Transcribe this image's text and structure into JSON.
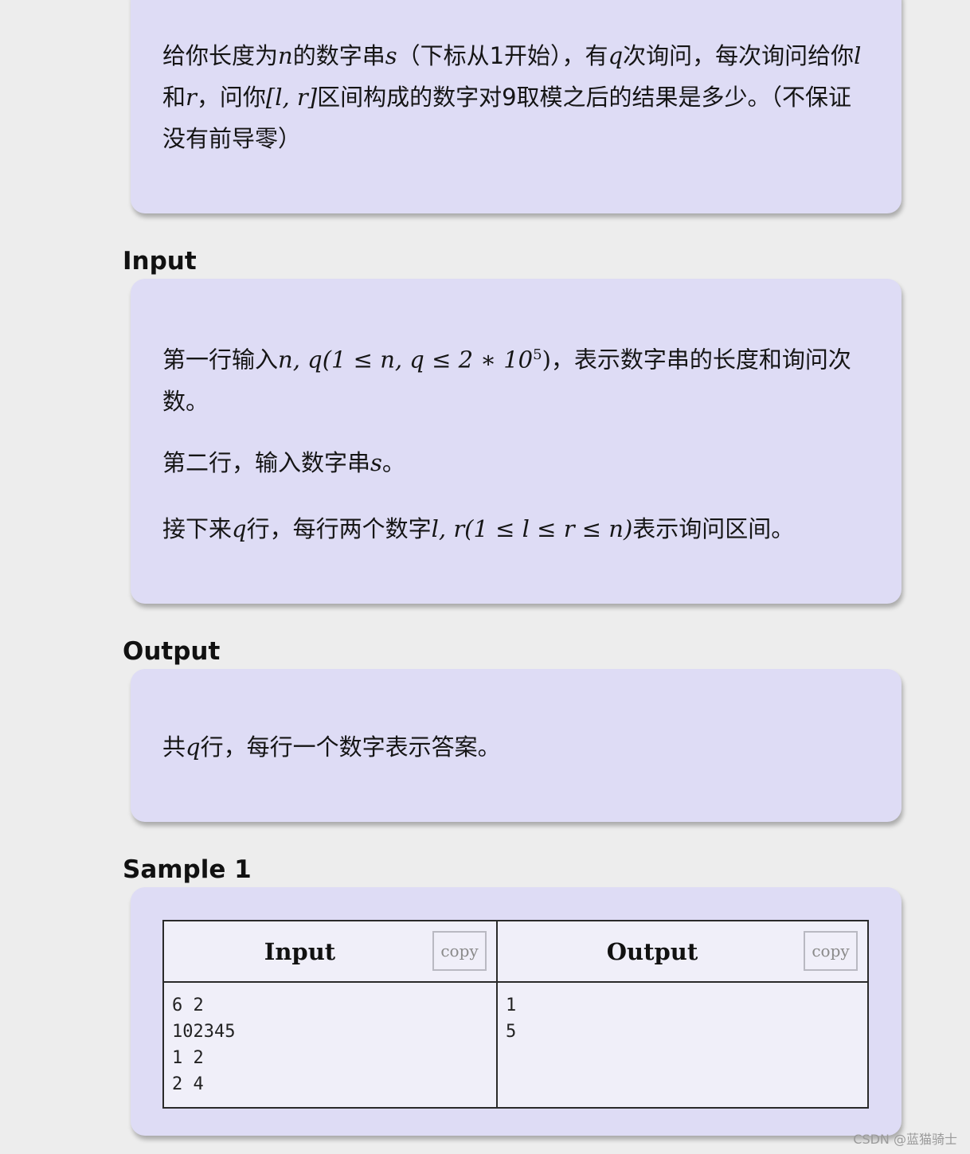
{
  "description": {
    "para1_a": "给你长度为",
    "para1_n": "n",
    "para1_b": "的数字串",
    "para1_s": "s",
    "para1_c": "（下标从1开始），有",
    "para1_q": "q",
    "para1_d": "次询问，每次询问给你",
    "para1_l": "l",
    "para1_e": "和",
    "para1_r": "r",
    "para1_f": "，问你",
    "para1_range": "[l, r]",
    "para1_g": "区间构成的数字对9取模之后的结果是多少。（不保证没有前导零）"
  },
  "input_section": {
    "heading": "Input",
    "line1_a": "第一行输入",
    "line1_math": "n, q(1 ≤ n, q ≤ 2 ∗ 10",
    "line1_exp": "5",
    "line1_close": ")",
    "line1_b": "，表示数字串的长度和询问次数。",
    "line2_a": "第二行，输入数字串",
    "line2_s": "s",
    "line2_b": "。",
    "line3_a": "接下来",
    "line3_q": "q",
    "line3_b": "行，每行两个数字",
    "line3_math": "l, r(1 ≤ l ≤ r ≤ n)",
    "line3_c": "表示询问区间。"
  },
  "output_section": {
    "heading": "Output",
    "line_a": "共",
    "line_q": "q",
    "line_b": "行，每行一个数字表示答案。"
  },
  "sample": {
    "heading": "Sample 1",
    "input_header": "Input",
    "output_header": "Output",
    "copy_label": "copy",
    "input_text": "6 2\n102345\n1 2\n2 4",
    "output_text": "1\n5"
  },
  "watermark": "CSDN @蓝猫骑士"
}
